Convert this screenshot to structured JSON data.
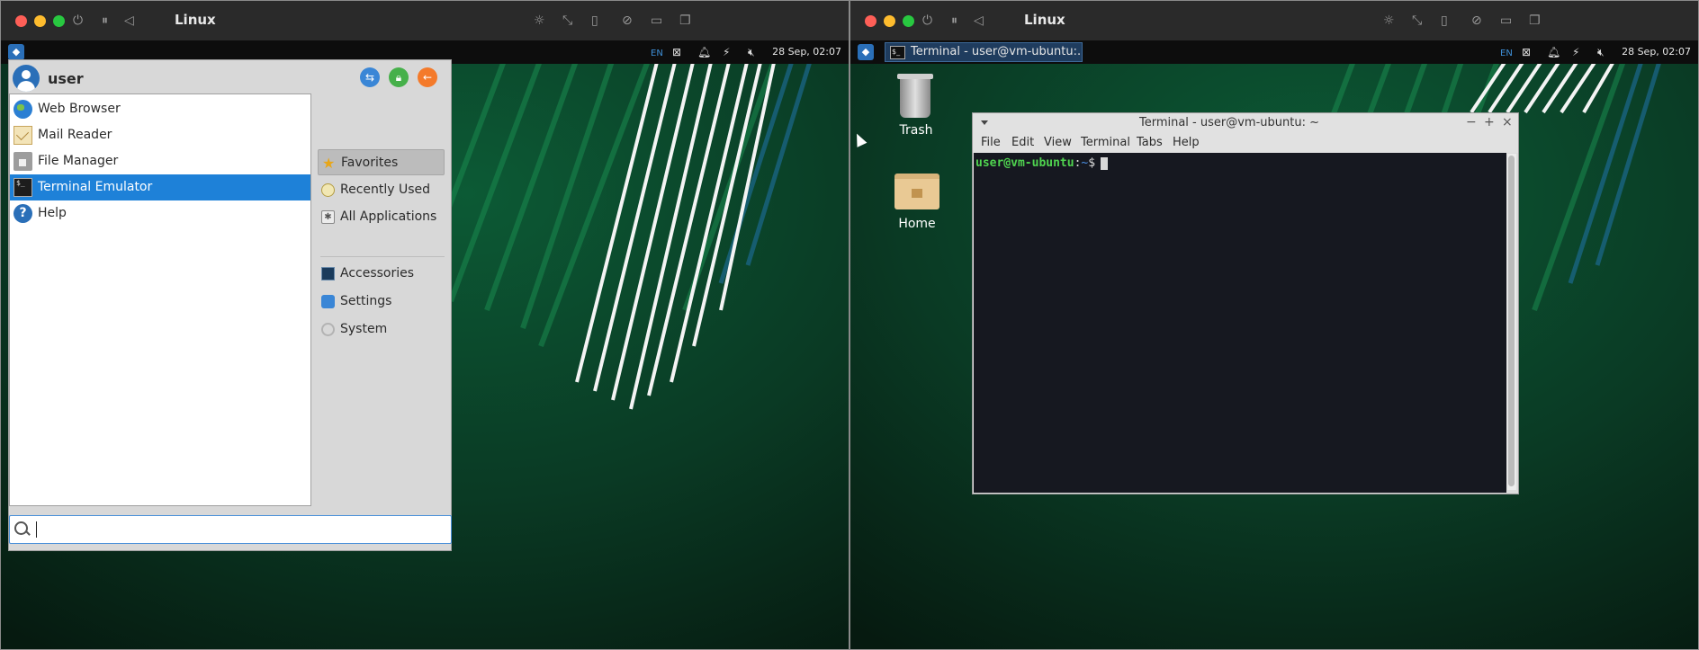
{
  "left": {
    "host": {
      "title": "Linux"
    },
    "panel": {
      "language": "EN",
      "clock": "28 Sep, 02:07"
    },
    "menu": {
      "username": "user",
      "favorites": [
        {
          "label": "Web Browser",
          "icon": "globe-icon"
        },
        {
          "label": "Mail Reader",
          "icon": "mail-icon"
        },
        {
          "label": "File Manager",
          "icon": "file-manager-icon"
        },
        {
          "label": "Terminal Emulator",
          "icon": "terminal-icon",
          "selected": true
        },
        {
          "label": "Help",
          "icon": "help-icon"
        }
      ],
      "categories": [
        {
          "label": "Favorites",
          "active": true
        },
        {
          "label": "Recently Used"
        },
        {
          "label": "All Applications"
        },
        {
          "label": "Accessories"
        },
        {
          "label": "Settings"
        },
        {
          "label": "System"
        }
      ],
      "search": {
        "value": ""
      }
    }
  },
  "right": {
    "host": {
      "title": "Linux"
    },
    "panel": {
      "language": "EN",
      "clock": "28 Sep, 02:07",
      "task_label": "Terminal - user@vm-ubuntu:..."
    },
    "desktop": {
      "trash_label": "Trash",
      "home_label": "Home"
    },
    "terminal": {
      "title": "Terminal - user@vm-ubuntu: ~",
      "menus": [
        "File",
        "Edit",
        "View",
        "Terminal",
        "Tabs",
        "Help"
      ],
      "prompt_user": "user@vm-ubuntu",
      "prompt_sep": ":",
      "prompt_path": "~",
      "prompt_symbol": "$"
    }
  },
  "colors": {
    "accent": "#1e81d8",
    "wallpaper": "#0b3a24",
    "prompt_user": "#4fd34f",
    "prompt_path": "#4a8ee3"
  }
}
